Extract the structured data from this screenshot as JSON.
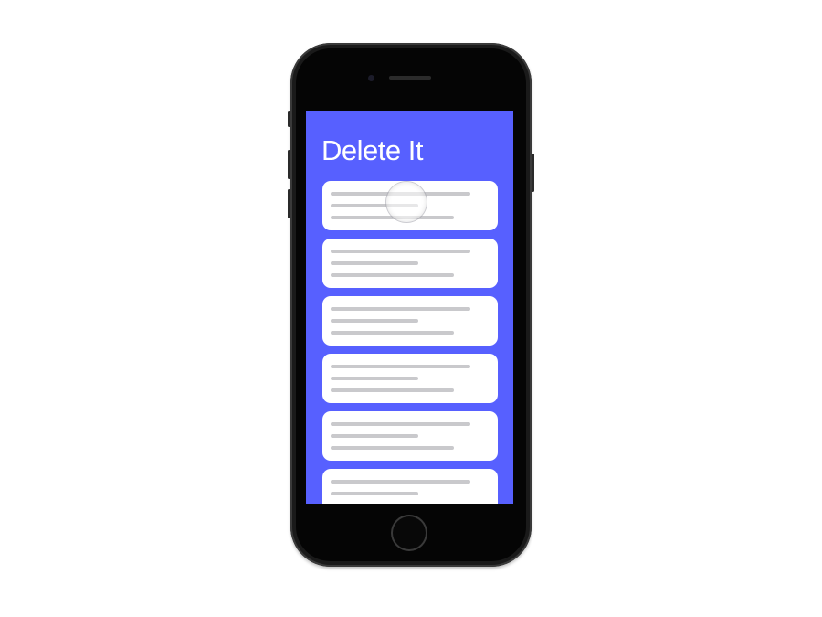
{
  "app": {
    "title": "Delete It"
  },
  "cards": [
    {
      "id": 1
    },
    {
      "id": 2
    },
    {
      "id": 3
    },
    {
      "id": 4
    },
    {
      "id": 5
    },
    {
      "id": 6
    }
  ],
  "colors": {
    "screen_background": "#5760ff",
    "card_background": "#ffffff",
    "placeholder_line": "#c9c9cc",
    "phone_body": "#1a1a1a"
  },
  "icons": {
    "touch": "touch-indicator-icon",
    "home": "home-button-icon"
  }
}
